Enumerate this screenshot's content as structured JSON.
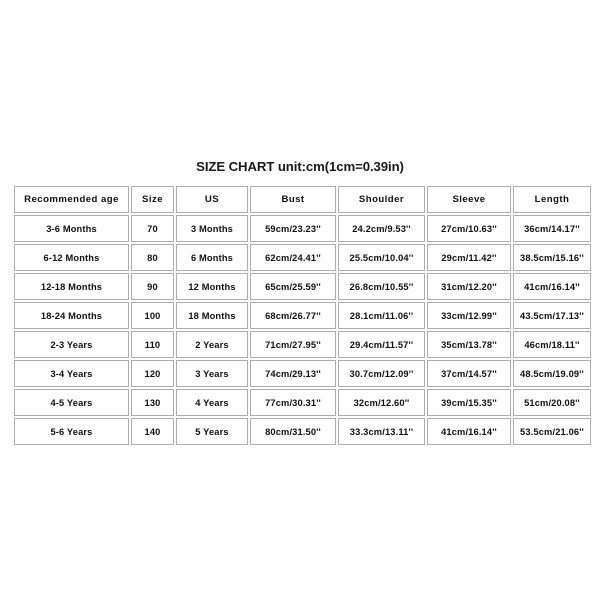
{
  "title": "SIZE CHART unit:cm(1cm=0.39in)",
  "chart_data": {
    "type": "table",
    "title": "SIZE CHART unit:cm(1cm=0.39in)",
    "columns": [
      "Recommended age",
      "Size",
      "US",
      "Bust",
      "Shoulder",
      "Sleeve",
      "Length"
    ],
    "rows": [
      [
        "3-6 Months",
        "70",
        "3 Months",
        "59cm/23.23''",
        "24.2cm/9.53''",
        "27cm/10.63''",
        "36cm/14.17''"
      ],
      [
        "6-12 Months",
        "80",
        "6 Months",
        "62cm/24.41''",
        "25.5cm/10.04''",
        "29cm/11.42''",
        "38.5cm/15.16''"
      ],
      [
        "12-18 Months",
        "90",
        "12 Months",
        "65cm/25.59''",
        "26.8cm/10.55''",
        "31cm/12.20''",
        "41cm/16.14''"
      ],
      [
        "18-24 Months",
        "100",
        "18 Months",
        "68cm/26.77''",
        "28.1cm/11.06''",
        "33cm/12.99''",
        "43.5cm/17.13''"
      ],
      [
        "2-3 Years",
        "110",
        "2 Years",
        "71cm/27.95''",
        "29.4cm/11.57''",
        "35cm/13.78''",
        "46cm/18.11''"
      ],
      [
        "3-4 Years",
        "120",
        "3 Years",
        "74cm/29.13''",
        "30.7cm/12.09''",
        "37cm/14.57''",
        "48.5cm/19.09''"
      ],
      [
        "4-5 Years",
        "130",
        "4 Years",
        "77cm/30.31''",
        "32cm/12.60''",
        "39cm/15.35''",
        "51cm/20.08''"
      ],
      [
        "5-6 Years",
        "140",
        "5 Years",
        "80cm/31.50''",
        "33.3cm/13.11''",
        "41cm/16.14''",
        "53.5cm/21.06''"
      ]
    ],
    "colors": {
      "background": "#ffffff",
      "border": "#adadad",
      "text": "#101010"
    }
  }
}
